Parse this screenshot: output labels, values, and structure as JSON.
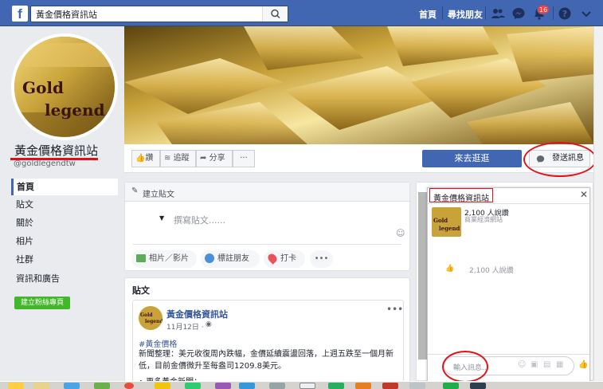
{
  "topbar": {
    "logo": "f",
    "search_value": "黃金價格資訊站",
    "nav_home": "首頁",
    "nav_find_friends": "尋找朋友",
    "notification_count": "16",
    "icons": [
      "friends-icon",
      "messenger-icon",
      "notifications-icon",
      "help-icon",
      "dropdown-icon"
    ]
  },
  "profile": {
    "avatar_text_line1": "Gold",
    "avatar_text_line2": "legend",
    "name": "黃金價格資訊站",
    "handle": "@goldlegendtw"
  },
  "left_nav": {
    "items": [
      "首頁",
      "貼文",
      "關於",
      "相片",
      "社群",
      "資訊和廣告"
    ],
    "create_page": "建立粉絲專頁"
  },
  "action_bar": {
    "like": "讚",
    "follow": "追蹤",
    "share": "分享",
    "more": "···",
    "visit": "來去逛逛",
    "send_message": "發送訊息"
  },
  "composer": {
    "title": "建立貼文",
    "placeholder": "撰寫貼文......",
    "photo_video": "相片／影片",
    "tag_friends": "標註朋友",
    "check_in": "打卡",
    "more": "•••"
  },
  "posts": {
    "header": "貼文",
    "author": "黃金價格資訊站",
    "date": "11月12日 · ",
    "hashtag": "#黃金價格",
    "body": "新聞整理：美元收復周內跌幅，金價延續震盪回落，上週五跌至一個月新低，目前金價微升至每盎司1209.8美元。",
    "more_line": "• 更多黃金新聞："
  },
  "chat": {
    "title": "黃金價格資訊站",
    "likes": "2,100 人說讚",
    "category": "商業經濟網站",
    "likes_row": "2,100 人說讚",
    "input_placeholder": "輸入訊息..."
  },
  "colors": {
    "brand": "#4267b2",
    "annotation_red": "#e0141b",
    "green": "#42b72a"
  }
}
